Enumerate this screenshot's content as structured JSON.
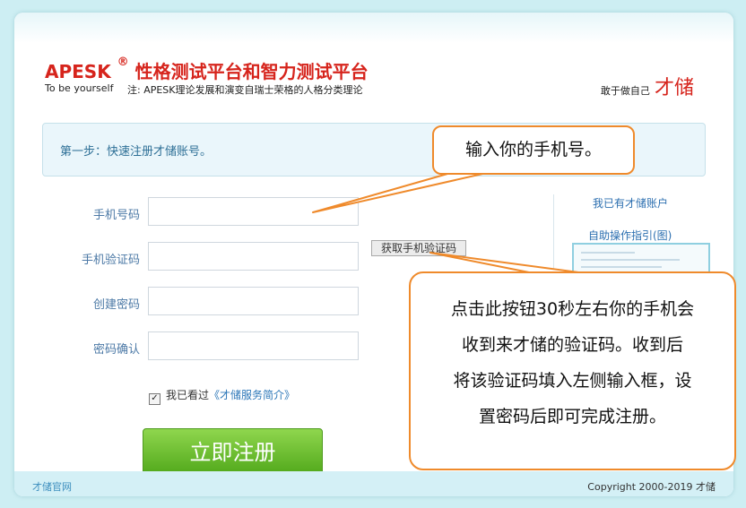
{
  "header": {
    "logo_brand": "APESK",
    "logo_reg": "®",
    "logo_title": "性格测试平台和智力测试平台",
    "tagline": "To be yourself",
    "subnote": "注:   APESK理论发展和演变自瑞士荣格的人格分类理论",
    "motto_small": "敢于做自己",
    "motto_big": "才储"
  },
  "step": {
    "text": "第一步：快速注册才储账号。"
  },
  "form": {
    "phone_label": "手机号码",
    "code_label": "手机验证码",
    "password_label": "创建密码",
    "confirm_label": "密码确认",
    "phone_value": "",
    "code_value": "",
    "password_value": "",
    "confirm_value": "",
    "get_code_button": "获取手机验证码",
    "agree_checked": true,
    "agree_text": "我已看过",
    "agree_link": "《才储服务简介》",
    "register_button": "立即注册"
  },
  "sidebar": {
    "have_account": "我已有才储账户",
    "guide_link": "自助操作指引(图)"
  },
  "footer": {
    "site_link": "才储官网",
    "copyright": "Copyright 2000-2019 才储"
  },
  "callouts": {
    "phone_tip": "输入你的手机号。",
    "code_tip_lines": [
      "点击此按钮30秒左右你的手机会",
      "收到来才储的验证码。收到后",
      "将该验证码填入左侧输入框，设",
      "置密码后即可完成注册。"
    ]
  },
  "colors": {
    "background": "#cdeef3",
    "brand_red": "#d6241c",
    "register_green": "#6cbf32",
    "callout_orange": "#ef8a2b",
    "link_blue": "#2c6fb0"
  }
}
